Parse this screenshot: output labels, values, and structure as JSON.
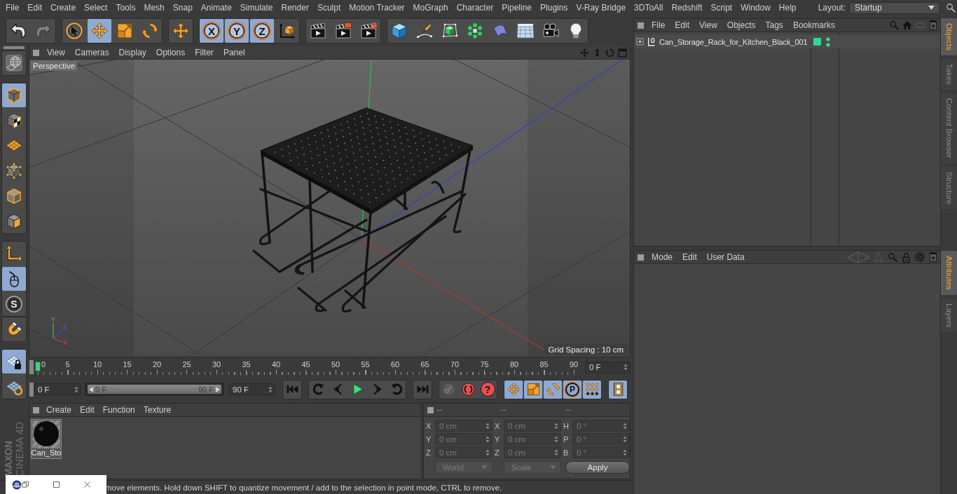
{
  "menu_bar": {
    "items": [
      "File",
      "Edit",
      "Create",
      "Select",
      "Tools",
      "Mesh",
      "Snap",
      "Animate",
      "Simulate",
      "Render",
      "Sculpt",
      "Motion Tracker",
      "MoGraph",
      "Character",
      "Pipeline",
      "Plugins",
      "V-Ray Bridge",
      "3DToAll",
      "Redshift",
      "Script",
      "Window",
      "Help"
    ],
    "layout_label": "Layout:",
    "layout_value": "Startup"
  },
  "toolbar": {
    "groups": [
      {
        "tools": [
          {
            "kind": "undo",
            "selected": false,
            "disabled": false
          },
          {
            "kind": "redo",
            "selected": false,
            "disabled": true
          }
        ]
      },
      {
        "tools": [
          {
            "kind": "live_selection",
            "selected": false,
            "disabled": false
          },
          {
            "kind": "move",
            "selected": true,
            "disabled": false
          },
          {
            "kind": "scale",
            "selected": false,
            "disabled": false
          },
          {
            "kind": "rotate",
            "selected": false,
            "disabled": false
          }
        ]
      },
      {
        "tools": [
          {
            "kind": "move",
            "selected": false,
            "disabled": false
          }
        ]
      },
      {
        "tools": [
          {
            "kind": "axis_lock",
            "label": "X",
            "selected": true,
            "disabled": false
          },
          {
            "kind": "axis_lock",
            "label": "Y",
            "selected": true,
            "disabled": false
          },
          {
            "kind": "axis_lock",
            "label": "Z",
            "selected": true,
            "disabled": false
          },
          {
            "kind": "coordinate_system",
            "selected": false,
            "disabled": false
          }
        ]
      },
      {
        "tools": [
          {
            "kind": "render_view",
            "selected": false,
            "disabled": false
          },
          {
            "kind": "render_picture",
            "selected": false,
            "disabled": false
          },
          {
            "kind": "render_settings",
            "selected": false,
            "disabled": false
          }
        ]
      },
      {
        "tools": [
          {
            "kind": "cube",
            "selected": false,
            "disabled": false
          },
          {
            "kind": "pen",
            "selected": false,
            "disabled": false
          },
          {
            "kind": "subdivision",
            "selected": false,
            "disabled": false
          },
          {
            "kind": "cloner",
            "selected": false,
            "disabled": false
          },
          {
            "kind": "deformer",
            "selected": false,
            "disabled": false
          },
          {
            "kind": "floor",
            "selected": false,
            "disabled": false
          },
          {
            "kind": "camera",
            "selected": false,
            "disabled": false
          },
          {
            "kind": "light",
            "selected": false,
            "disabled": false
          }
        ]
      }
    ]
  },
  "side_toolbar": {
    "groups": [
      {
        "tools": [
          {
            "kind": "make_editable",
            "selected": false,
            "disabled": false
          }
        ]
      },
      {
        "tools": [
          {
            "kind": "model",
            "selected": true,
            "disabled": false
          },
          {
            "kind": "texture",
            "selected": false,
            "disabled": false
          },
          {
            "kind": "workplane",
            "selected": false,
            "disabled": false
          },
          {
            "kind": "points",
            "selected": false,
            "disabled": false
          },
          {
            "kind": "edges",
            "selected": false,
            "disabled": false
          },
          {
            "kind": "polygons",
            "selected": false,
            "disabled": false
          }
        ]
      },
      {
        "tools": [
          {
            "kind": "axis",
            "selected": false,
            "disabled": false
          },
          {
            "kind": "tweak",
            "selected": true,
            "disabled": false
          },
          {
            "kind": "solo",
            "label": "S",
            "selected": false,
            "disabled": false
          }
        ]
      },
      {
        "tools": [
          {
            "kind": "snap",
            "selected": false,
            "disabled": false
          }
        ]
      },
      {
        "tools": [
          {
            "kind": "locked_workplane",
            "selected": true,
            "disabled": false
          },
          {
            "kind": "planar_workplane",
            "selected": false,
            "disabled": false
          }
        ]
      }
    ]
  },
  "logo": {
    "brand": "MAXON",
    "product": "CINEMA 4D"
  },
  "viewport": {
    "menu": [
      "View",
      "Cameras",
      "Display",
      "Options",
      "Filter",
      "Panel"
    ],
    "camera_label": "Perspective",
    "grid_label": "Grid Spacing : 10 cm",
    "gizmo_labels": [
      "Y",
      "Z",
      "X"
    ]
  },
  "timeline": {
    "ticks": [
      "0",
      "5",
      "10",
      "15",
      "20",
      "25",
      "30",
      "35",
      "40",
      "45",
      "50",
      "55",
      "60",
      "65",
      "70",
      "75",
      "80",
      "85",
      "90"
    ],
    "level": 0,
    "current_frame": "0 F"
  },
  "playback": {
    "start_frame": "0 F",
    "range": {
      "start": "0 F",
      "end": "90 F",
      "level": 1
    },
    "end_frame": "90 F",
    "groups": [
      {
        "buttons": [
          {
            "kind": "go_start",
            "selected": false,
            "disabled": false
          }
        ]
      },
      {
        "buttons": [
          {
            "kind": "prev_key",
            "selected": false,
            "disabled": false
          },
          {
            "kind": "prev_frame",
            "selected": false,
            "disabled": false
          },
          {
            "kind": "play",
            "selected": false,
            "disabled": false
          },
          {
            "kind": "next_frame",
            "selected": false,
            "disabled": false
          },
          {
            "kind": "next_key",
            "selected": false,
            "disabled": false
          }
        ]
      },
      {
        "buttons": [
          {
            "kind": "go_end",
            "selected": false,
            "disabled": false
          }
        ]
      },
      {
        "buttons": [
          {
            "kind": "record",
            "selected": false,
            "disabled": true
          },
          {
            "kind": "autokey",
            "selected": false,
            "disabled": false
          },
          {
            "kind": "selection_keys",
            "label": "?",
            "selected": false,
            "disabled": false
          }
        ]
      },
      {
        "buttons": [
          {
            "kind": "key_position",
            "selected": true,
            "disabled": false
          },
          {
            "kind": "key_scale",
            "selected": true,
            "disabled": false
          },
          {
            "kind": "key_rotation",
            "selected": true,
            "disabled": false
          },
          {
            "kind": "key_parameter",
            "label": "P",
            "selected": true,
            "disabled": false
          },
          {
            "kind": "key_point_level",
            "selected": true,
            "disabled": false
          }
        ]
      },
      {
        "buttons": [
          {
            "kind": "timeline",
            "selected": true,
            "disabled": false
          }
        ]
      }
    ]
  },
  "materials": {
    "menu": [
      "Create",
      "Edit",
      "Function",
      "Texture"
    ],
    "items": [
      {
        "name": "Can_Sto",
        "selected": false
      }
    ]
  },
  "coordinates": {
    "disabled": true,
    "headers": [
      "--",
      "--",
      "--"
    ],
    "rows": [
      [
        {
          "axis": "X",
          "value": "0 cm"
        },
        {
          "axis": "X",
          "value": "0 cm"
        },
        {
          "axis": "H",
          "value": "0 °"
        }
      ],
      [
        {
          "axis": "Y",
          "value": "0 cm"
        },
        {
          "axis": "Y",
          "value": "0 cm"
        },
        {
          "axis": "P",
          "value": "0 °"
        }
      ],
      [
        {
          "axis": "Z",
          "value": "0 cm"
        },
        {
          "axis": "Z",
          "value": "0 cm"
        },
        {
          "axis": "B",
          "value": "0 °"
        }
      ]
    ],
    "position_mode": "World",
    "size_mode": "Scale",
    "apply": "Apply"
  },
  "status_bar": {
    "text": "move elements. Hold down SHIFT to quantize movement / add to the selection in point mode, CTRL to remove."
  },
  "objects": {
    "menu": [
      "File",
      "Edit",
      "View",
      "Objects",
      "Tags",
      "Bookmarks"
    ],
    "items": [
      {
        "name": "Can_Storage_Rack_for_Kitchen_Black_001",
        "expanded": false,
        "selected": false
      }
    ]
  },
  "top_tabs": [
    {
      "label": "Objects",
      "selected": true
    },
    {
      "label": "Takes",
      "selected": false
    },
    {
      "label": "Content Browser",
      "selected": false
    },
    {
      "label": "Structure",
      "selected": false
    }
  ],
  "attributes": {
    "menu": [
      "Mode",
      "Edit",
      "User Data"
    ]
  },
  "bottom_tabs": [
    {
      "label": "Attributes",
      "selected": true
    },
    {
      "label": "Layers",
      "selected": false
    }
  ],
  "mini_window": {
    "buttons": [
      {
        "kind": "restore"
      },
      {
        "kind": "maximize"
      },
      {
        "kind": "close"
      }
    ]
  }
}
